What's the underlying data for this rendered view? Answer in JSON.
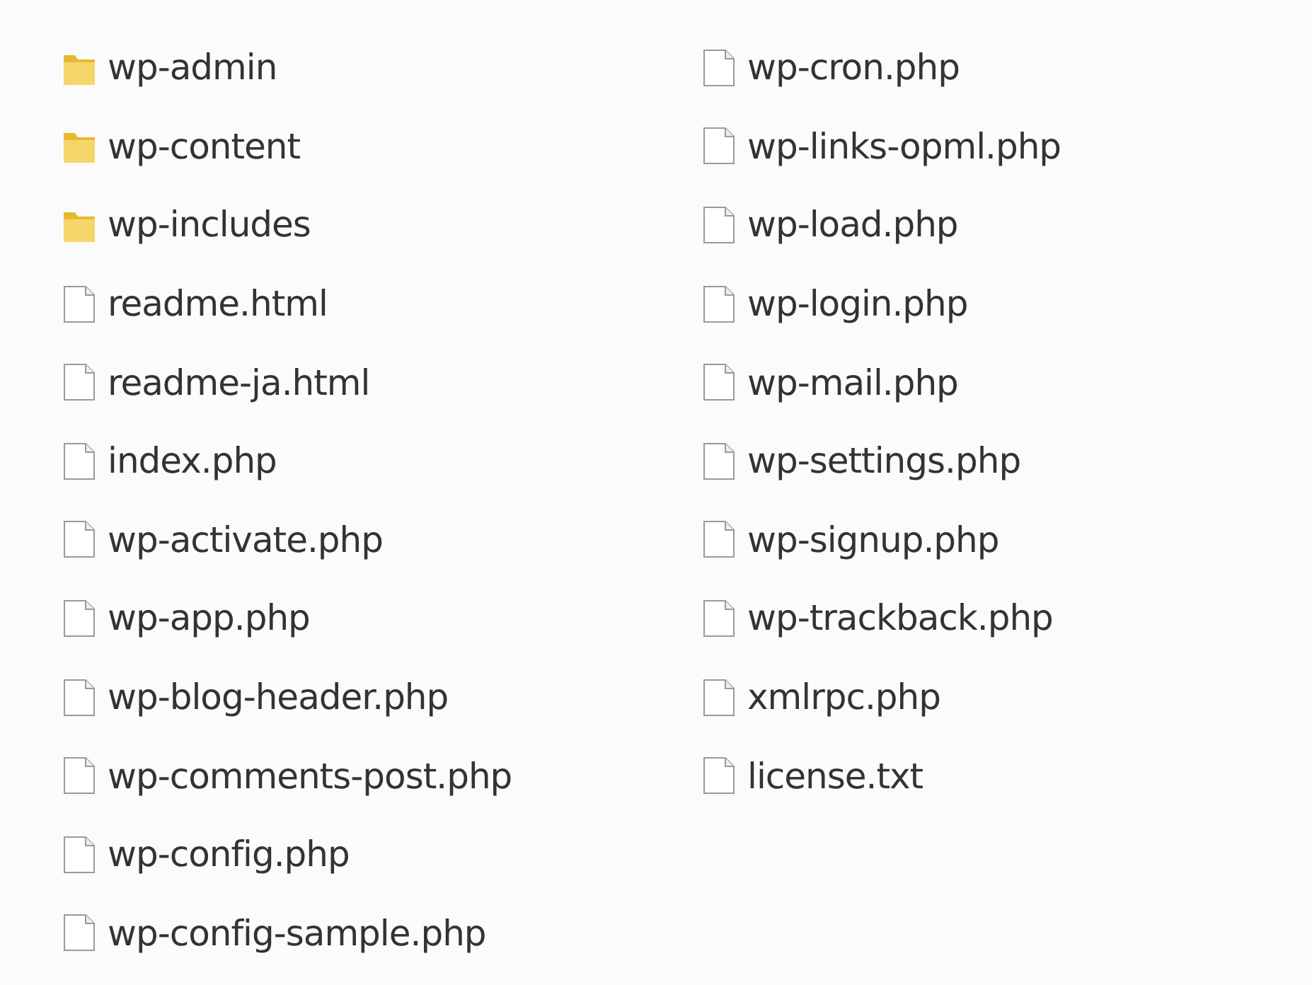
{
  "items": [
    {
      "name": "wp-admin",
      "kind": "folder"
    },
    {
      "name": "wp-content",
      "kind": "folder"
    },
    {
      "name": "wp-includes",
      "kind": "folder"
    },
    {
      "name": "readme.html",
      "kind": "file"
    },
    {
      "name": "readme-ja.html",
      "kind": "file"
    },
    {
      "name": "index.php",
      "kind": "file"
    },
    {
      "name": "wp-activate.php",
      "kind": "file"
    },
    {
      "name": "wp-app.php",
      "kind": "file"
    },
    {
      "name": "wp-blog-header.php",
      "kind": "file"
    },
    {
      "name": "wp-comments-post.php",
      "kind": "file"
    },
    {
      "name": "wp-config.php",
      "kind": "file"
    },
    {
      "name": "wp-config-sample.php",
      "kind": "file"
    },
    {
      "name": "wp-cron.php",
      "kind": "file"
    },
    {
      "name": "wp-links-opml.php",
      "kind": "file"
    },
    {
      "name": "wp-load.php",
      "kind": "file"
    },
    {
      "name": "wp-login.php",
      "kind": "file"
    },
    {
      "name": "wp-mail.php",
      "kind": "file"
    },
    {
      "name": "wp-settings.php",
      "kind": "file"
    },
    {
      "name": "wp-signup.php",
      "kind": "file"
    },
    {
      "name": "wp-trackback.php",
      "kind": "file"
    },
    {
      "name": "xmlrpc.php",
      "kind": "file"
    },
    {
      "name": "license.txt",
      "kind": "file"
    }
  ]
}
